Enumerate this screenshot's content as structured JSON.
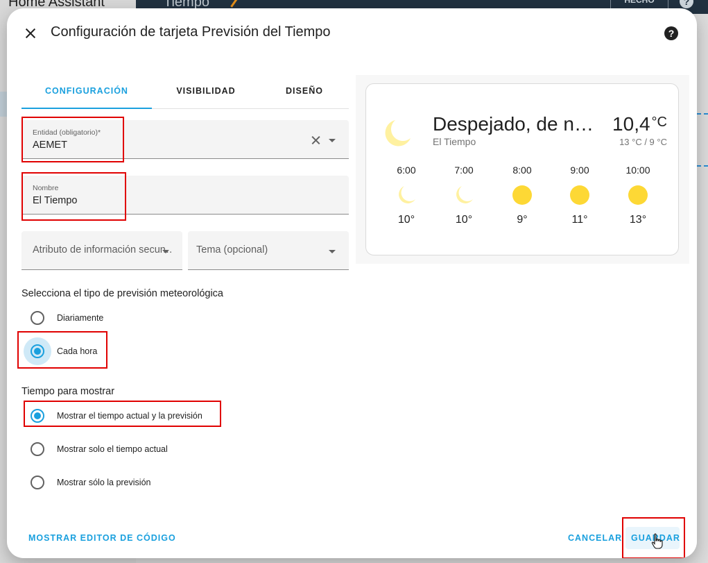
{
  "background": {
    "app_title": "Home Assistant",
    "dashboard_title": "Tiempo",
    "done_label": "HECHO",
    "help_glyph": "?"
  },
  "dialog": {
    "title": "Configuración de tarjeta Previsión del Tiempo",
    "help_glyph": "?"
  },
  "tabs": [
    {
      "label": "CONFIGURACIÓN",
      "active": true
    },
    {
      "label": "VISIBILIDAD",
      "active": false
    },
    {
      "label": "DISEÑO",
      "active": false
    }
  ],
  "form": {
    "entity": {
      "label": "Entidad (obligatorio)*",
      "value": "AEMET"
    },
    "name": {
      "label": "Nombre",
      "value": "El Tiempo"
    },
    "secondary_attribute": {
      "placeholder": "Atributo de información secundaria (opcional)",
      "display": "Atributo de información secun…"
    },
    "theme": {
      "placeholder": "Tema (opcional)"
    },
    "forecast_type": {
      "label": "Selecciona el tipo de previsión meteorológica",
      "options": [
        {
          "label": "Diariamente",
          "selected": false
        },
        {
          "label": "Cada hora",
          "selected": true
        }
      ]
    },
    "show_mode": {
      "label": "Tiempo para mostrar",
      "options": [
        {
          "label": "Mostrar el tiempo actual y la previsión",
          "selected": true
        },
        {
          "label": "Mostrar solo el tiempo actual",
          "selected": false
        },
        {
          "label": "Mostrar sólo la previsión",
          "selected": false
        }
      ]
    }
  },
  "preview": {
    "condition": "Despejado, de noche",
    "entity_name": "El Tiempo",
    "temperature": "10,4",
    "unit": "°C",
    "hilo": "13 °C / 9 °C",
    "forecast": [
      {
        "time": "6:00",
        "icon": "moon-icon",
        "temp": "10°"
      },
      {
        "time": "7:00",
        "icon": "moon-icon",
        "temp": "10°"
      },
      {
        "time": "8:00",
        "icon": "sun-icon",
        "temp": "9°"
      },
      {
        "time": "9:00",
        "icon": "sun-icon",
        "temp": "11°"
      },
      {
        "time": "10:00",
        "icon": "sun-icon",
        "temp": "13°"
      }
    ]
  },
  "footer": {
    "code_editor_label": "MOSTRAR EDITOR DE CÓDIGO",
    "cancel_label": "CANCELAR",
    "save_label": "GUARDAR"
  },
  "colors": {
    "accent": "#1aa0de",
    "highlight_box": "#e00000",
    "moon": "#fff1a0",
    "sun": "#fdd835"
  }
}
